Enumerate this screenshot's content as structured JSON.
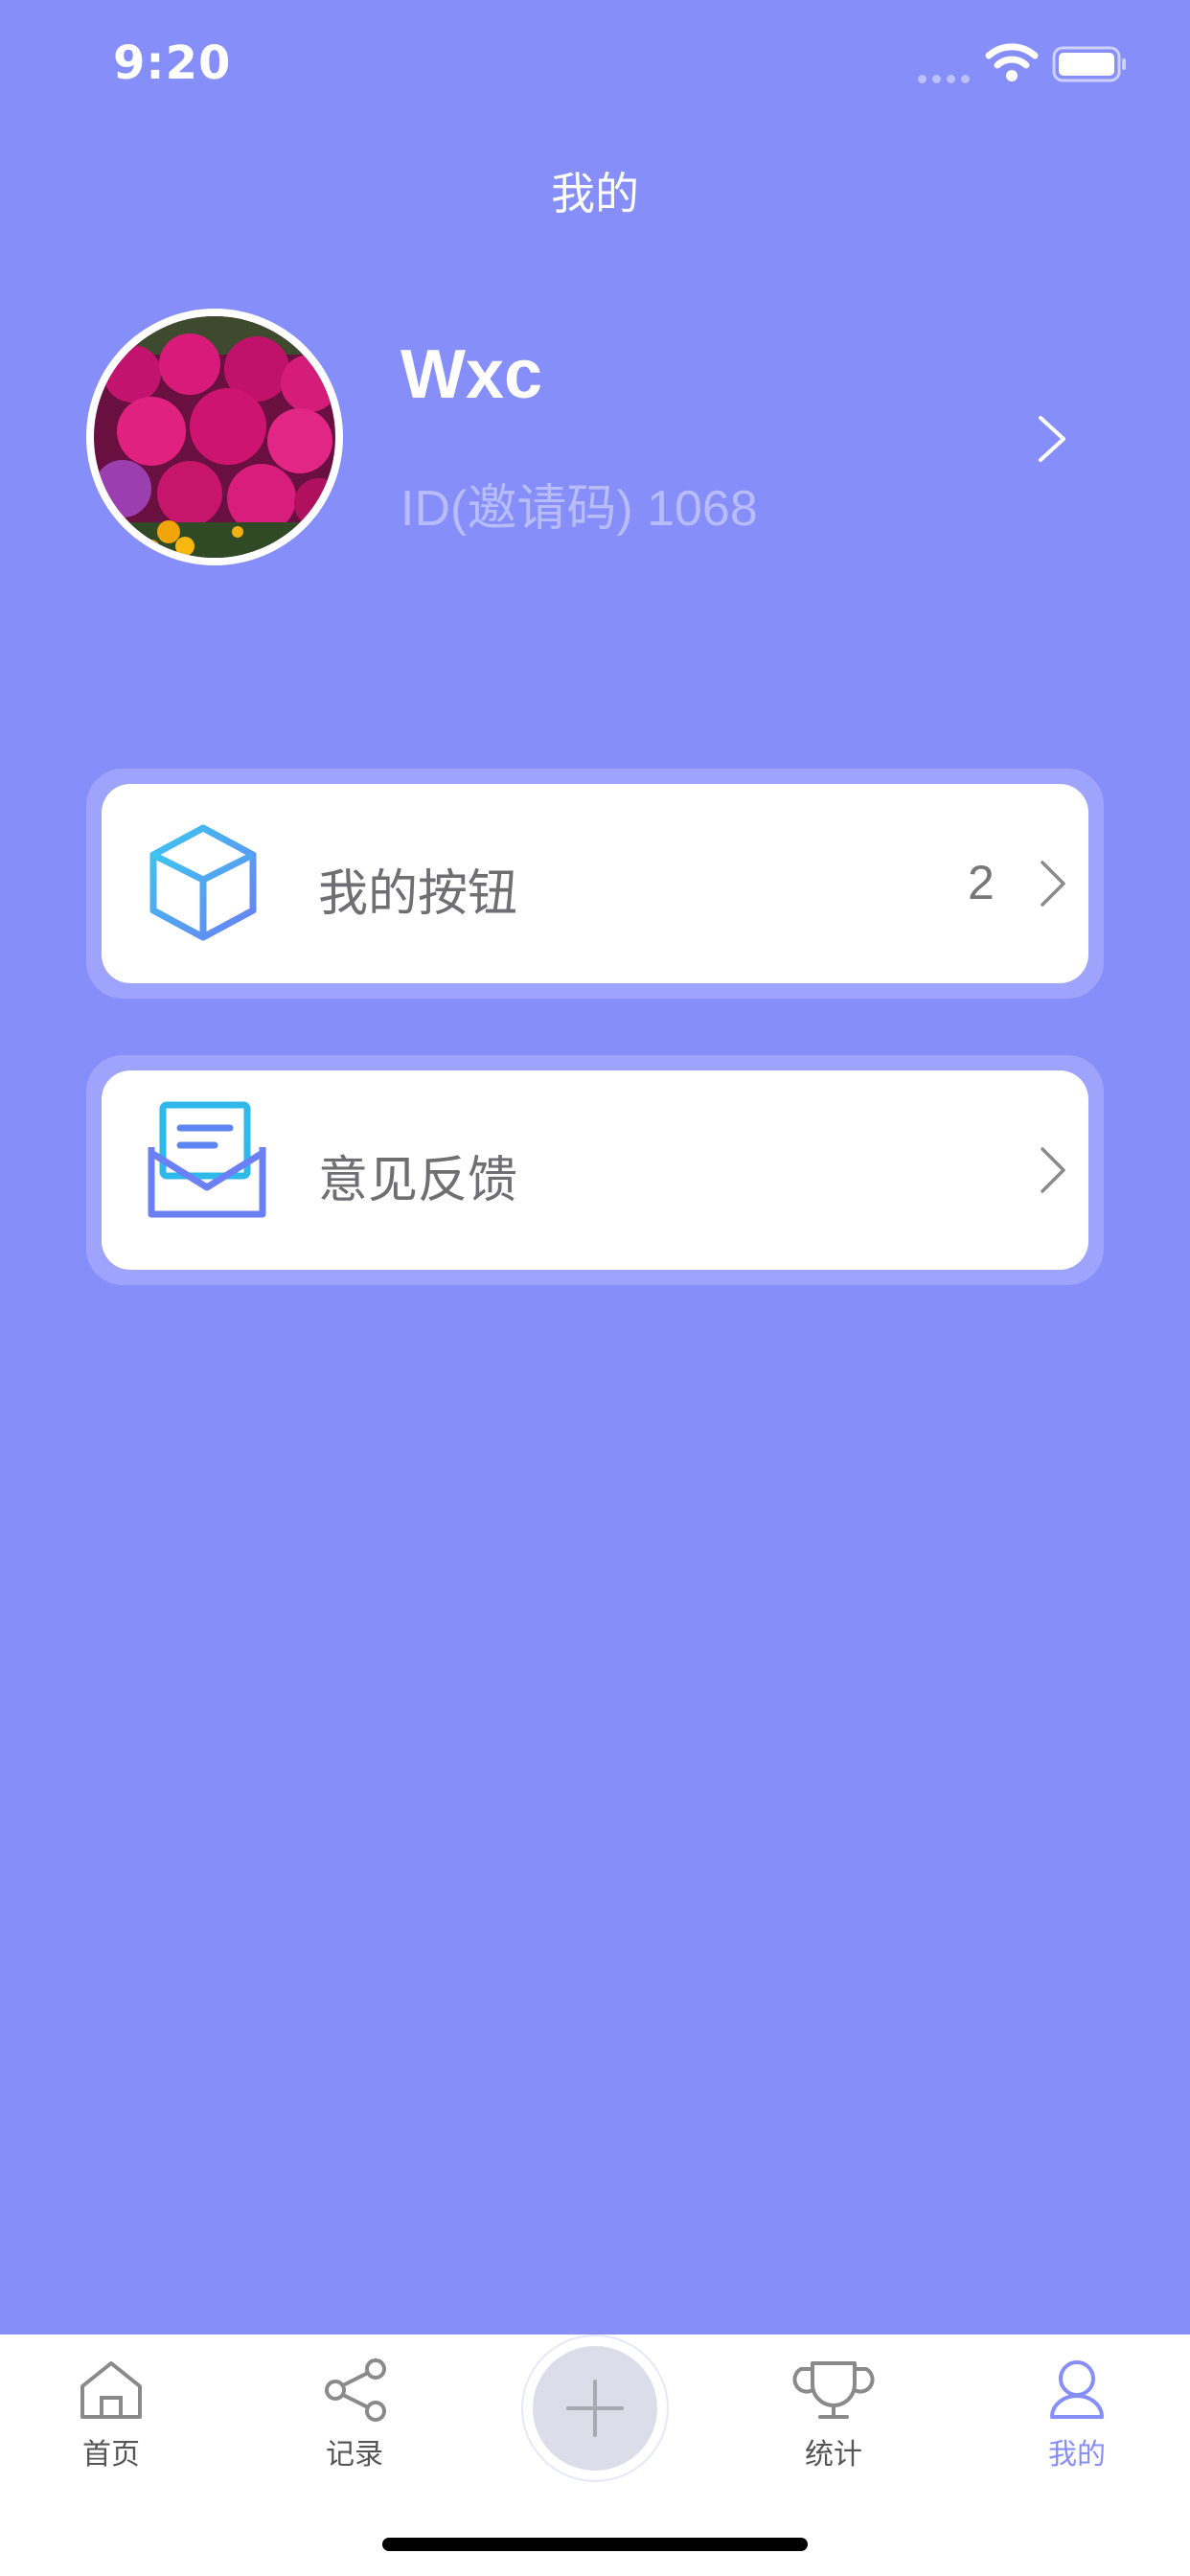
{
  "status_bar": {
    "time": "9:20"
  },
  "header": {
    "title": "我的"
  },
  "profile": {
    "name": "Wxc",
    "id_text": "ID(邀请码) 1068"
  },
  "menu": [
    {
      "label": "我的按钮",
      "badge": "2",
      "icon": "cube-icon"
    },
    {
      "label": "意见反馈",
      "badge": "",
      "icon": "envelope-icon"
    }
  ],
  "tabbar": {
    "items": [
      {
        "label": "首页",
        "icon": "home-icon"
      },
      {
        "label": "记录",
        "icon": "share-icon"
      },
      {
        "label": "统计",
        "icon": "trophy-icon"
      },
      {
        "label": "我的",
        "icon": "person-icon"
      }
    ],
    "active_index": 3,
    "center_action_icon": "plus-icon"
  },
  "colors": {
    "background": "#868efa",
    "card": "#ffffff",
    "accent": "#868efa",
    "id_text": "#b8bcf9"
  }
}
